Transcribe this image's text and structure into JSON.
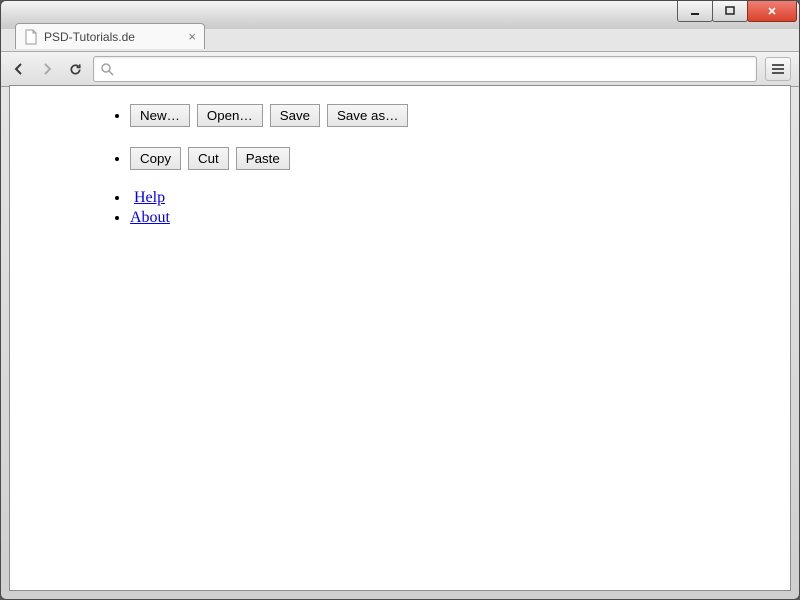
{
  "tab": {
    "title": "PSD-Tutorials.de"
  },
  "omnibox": {
    "value": ""
  },
  "menu": {
    "file": {
      "new": "New…",
      "open": "Open…",
      "save": "Save",
      "saveas": "Save as…"
    },
    "edit": {
      "copy": "Copy",
      "cut": "Cut",
      "paste": "Paste"
    },
    "links": {
      "help": "Help",
      "about": "About"
    }
  }
}
